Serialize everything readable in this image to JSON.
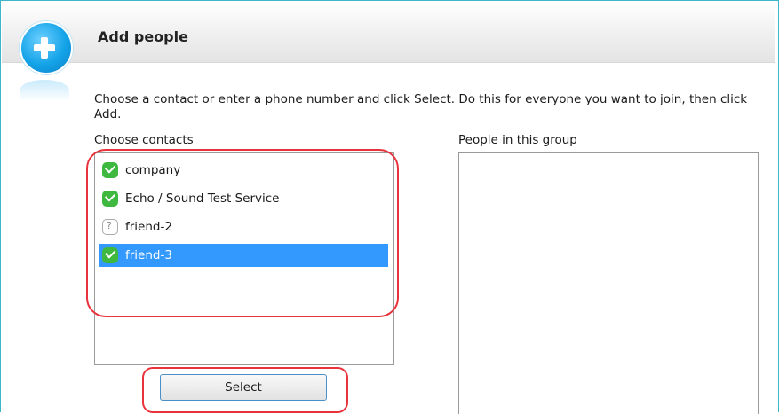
{
  "dialog": {
    "title": "Add people",
    "instructions": "Choose a contact or enter a phone number and click Select. Do this for everyone you want to join, then click Add.",
    "choose_contacts_label": "Choose contacts",
    "group_label": "People in this group",
    "select_button": "Select"
  },
  "contacts": [
    {
      "name": "company",
      "status": "online"
    },
    {
      "name": "Echo / Sound Test Service",
      "status": "online"
    },
    {
      "name": "friend-2",
      "status": "unknown"
    },
    {
      "name": "friend-3",
      "status": "online",
      "selected": true
    }
  ],
  "colors": {
    "accent": "#3fb6c7",
    "selection": "#3399ff",
    "highlight": "#e8323c",
    "online": "#3fb83f"
  }
}
